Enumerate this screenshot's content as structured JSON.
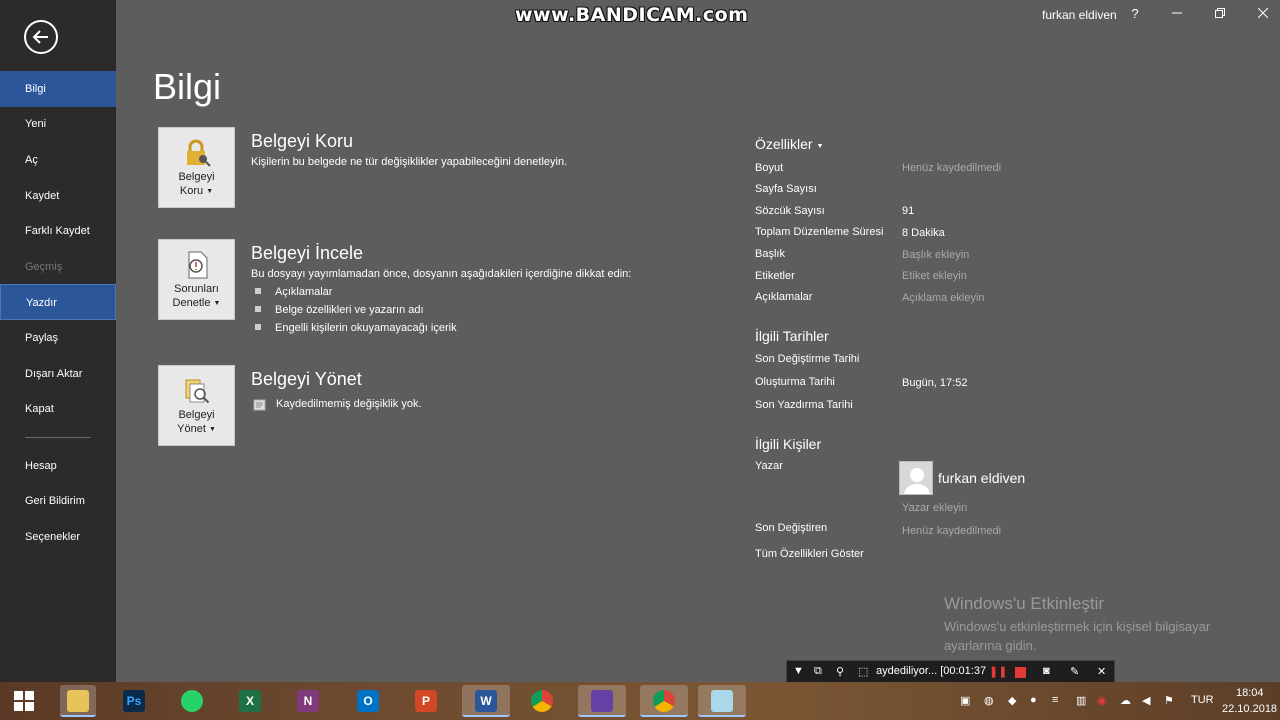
{
  "watermark": "www.BANDICAM.com",
  "titlebar": {
    "user": "furkan eldiven",
    "help": "?"
  },
  "sidebar": {
    "items": [
      {
        "label": "Bilgi"
      },
      {
        "label": "Yeni"
      },
      {
        "label": "Aç"
      },
      {
        "label": "Kaydet"
      },
      {
        "label": "Farklı Kaydet"
      },
      {
        "label": "Geçmiş"
      },
      {
        "label": "Yazdır"
      },
      {
        "label": "Paylaş"
      },
      {
        "label": "Dışarı Aktar"
      },
      {
        "label": "Kapat"
      },
      {
        "label": "Hesap"
      },
      {
        "label": "Geri Bildirim"
      },
      {
        "label": "Seçenekler"
      }
    ]
  },
  "page": {
    "title": "Bilgi"
  },
  "sections": {
    "protect": {
      "tile_line1": "Belgeyi",
      "tile_line2": "Koru",
      "title": "Belgeyi Koru",
      "desc": "Kişilerin bu belgede ne tür değişiklikler yapabileceğini denetleyin."
    },
    "inspect": {
      "tile_line1": "Sorunları",
      "tile_line2": "Denetle",
      "title": "Belgeyi İncele",
      "desc": "Bu dosyayı yayımlamadan önce, dosyanın aşağıdakileri içerdiğine dikkat edin:",
      "bullets": [
        "Açıklamalar",
        "Belge özellikleri ve yazarın adı",
        "Engelli kişilerin okuyamayacağı içerik"
      ]
    },
    "manage": {
      "tile_line1": "Belgeyi",
      "tile_line2": "Yönet",
      "title": "Belgeyi Yönet",
      "desc": "Kaydedilmemiş değişiklik yok."
    }
  },
  "properties": {
    "heading": "Özellikler",
    "rows": [
      {
        "label": "Boyut",
        "value": "Henüz kaydedilmedi"
      },
      {
        "label": "Sayfa Sayısı",
        "value": ""
      },
      {
        "label": "Sözcük Sayısı",
        "value": "91"
      },
      {
        "label": "Toplam Düzenleme Süresi",
        "value": "8 Dakika"
      },
      {
        "label": "Başlık",
        "value": "Başlık ekleyin"
      },
      {
        "label": "Etiketler",
        "value": "Etiket ekleyin"
      },
      {
        "label": "Açıklamalar",
        "value": "Açıklama ekleyin"
      }
    ],
    "dates_heading": "İlgili Tarihler",
    "dates": [
      {
        "label": "Son Değiştirme Tarihi",
        "value": ""
      },
      {
        "label": "Oluşturma Tarihi",
        "value": "Bugün, 17:52"
      },
      {
        "label": "Son Yazdırma Tarihi",
        "value": ""
      }
    ],
    "people_heading": "İlgili Kişiler",
    "author_label": "Yazar",
    "author_name": "furkan eldiven",
    "add_author": "Yazar ekleyin",
    "last_modified_by_label": "Son Değiştiren",
    "last_modified_by_value": "Henüz kaydedilmedi",
    "show_all": "Tüm Özellikleri Göster"
  },
  "activation": {
    "title": "Windows'u Etkinleştir",
    "text": "Windows'u etkinleştirmek için kişisel bilgisayar ayarlarına gidin."
  },
  "recorder": {
    "status": "aydediliyor... [00:01:37"
  },
  "taskbar": {
    "apps": [
      "Ps",
      "W",
      "X",
      "N",
      "O",
      "P",
      "W",
      "",
      "",
      "",
      ""
    ],
    "lang": "TUR",
    "time": "18:04",
    "date": "22.10.2018"
  },
  "colors": {
    "sidebar_bg": "#2b2b2b",
    "accent": "#2b579a",
    "page_bg": "#5d5d5d"
  }
}
